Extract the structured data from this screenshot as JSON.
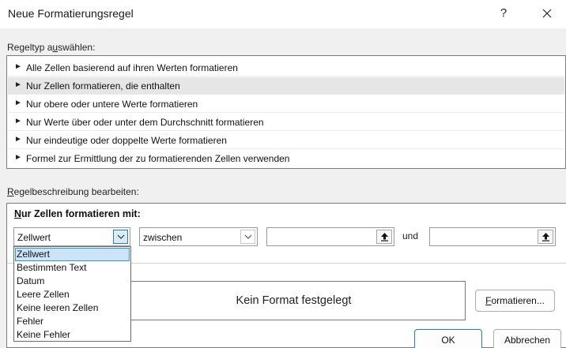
{
  "window": {
    "title": "Neue Formatierungsregel",
    "help_label": "?",
    "close_label": "✕"
  },
  "rule_type": {
    "label_pre": "Regeltyp a",
    "label_accel": "u",
    "label_post": "swählen:",
    "selected_index": 1,
    "items": [
      {
        "label": "Alle Zellen basierend auf ihren Werten formatieren"
      },
      {
        "label": "Nur Zellen formatieren, die enthalten"
      },
      {
        "label": "Nur obere oder untere Werte formatieren"
      },
      {
        "label": "Nur Werte über oder unter dem Durchschnitt formatieren"
      },
      {
        "label": "Nur eindeutige oder doppelte Werte formatieren"
      },
      {
        "label": "Formel zur Ermittlung der zu formatierenden Zellen verwenden"
      }
    ]
  },
  "rule_description": {
    "label_accel": "R",
    "label_post": "egelbeschreibung bearbeiten:",
    "heading_accel": "N",
    "heading_post": "ur Zellen formatieren mit:",
    "condition_combo_value": "Zellwert",
    "operator_combo_value": "zwischen",
    "value1": "",
    "value2": "",
    "and_label": "und",
    "dropdown_options": [
      "Zellwert",
      "Bestimmten Text",
      "Datum",
      "Leere Zellen",
      "Keine leeren Zellen",
      "Fehler",
      "Keine Fehler"
    ],
    "dropdown_selected_index": 0
  },
  "preview": {
    "text": "Kein Format festgelegt",
    "format_button_accel": "F",
    "format_button_post": "ormatieren..."
  },
  "footer": {
    "ok_label": "OK",
    "cancel_label": "Abbrechen"
  },
  "icons": {
    "list_arrow": "right-pointer-icon",
    "combo_arrow": "chevron-down-icon",
    "ref_button": "collapse-dialog-icon"
  }
}
